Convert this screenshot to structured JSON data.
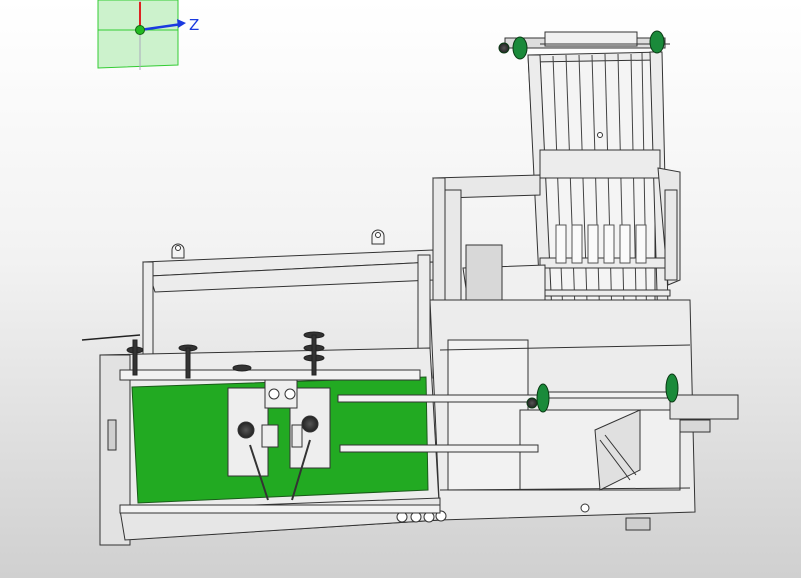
{
  "viewport": {
    "background": [
      "#ffffff",
      "#d0d0d0"
    ],
    "model_fill": "#ececec",
    "model_stroke": "#3a3a3a",
    "panel_color": "#22aa22",
    "sprocket_color": "#1a8a3a"
  },
  "triad": {
    "z_label": "Z",
    "x_color": "#d22",
    "y_color": "#22bb22",
    "z_color": "#1a3ae0"
  }
}
